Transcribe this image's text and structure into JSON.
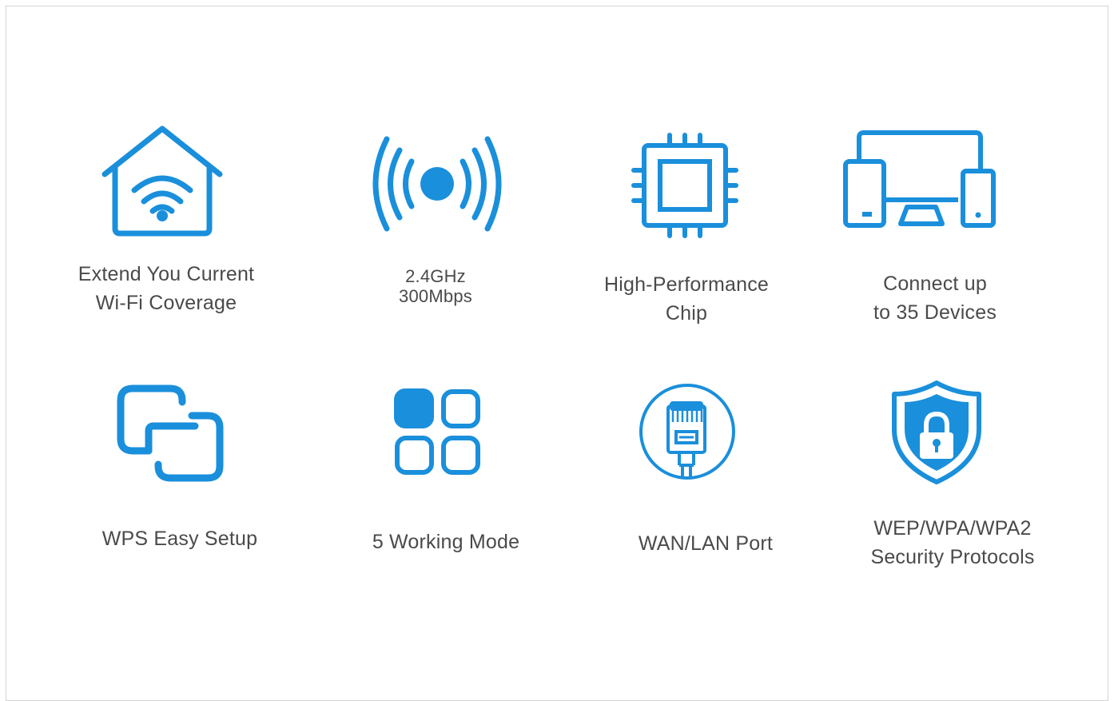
{
  "accent_color": "#1a8fdb",
  "features": [
    {
      "icon": "home-wifi-icon",
      "lines": [
        "Extend You Current",
        "Wi-Fi Coverage"
      ]
    },
    {
      "icon": "wireless-signal-icon",
      "lines": [
        "2.4GHz",
        "300Mbps"
      ]
    },
    {
      "icon": "chip-icon",
      "lines": [
        "High-Performance",
        "Chip"
      ]
    },
    {
      "icon": "devices-icon",
      "lines": [
        "Connect up",
        "to 35 Devices"
      ]
    },
    {
      "icon": "link-icon",
      "lines": [
        "WPS Easy Setup"
      ]
    },
    {
      "icon": "grid-modes-icon",
      "lines": [
        "5 Working Mode"
      ]
    },
    {
      "icon": "ethernet-port-icon",
      "lines": [
        "WAN/LAN Port"
      ]
    },
    {
      "icon": "security-shield-icon",
      "lines": [
        "WEP/WPA/WPA2",
        "Security Protocols"
      ]
    }
  ]
}
